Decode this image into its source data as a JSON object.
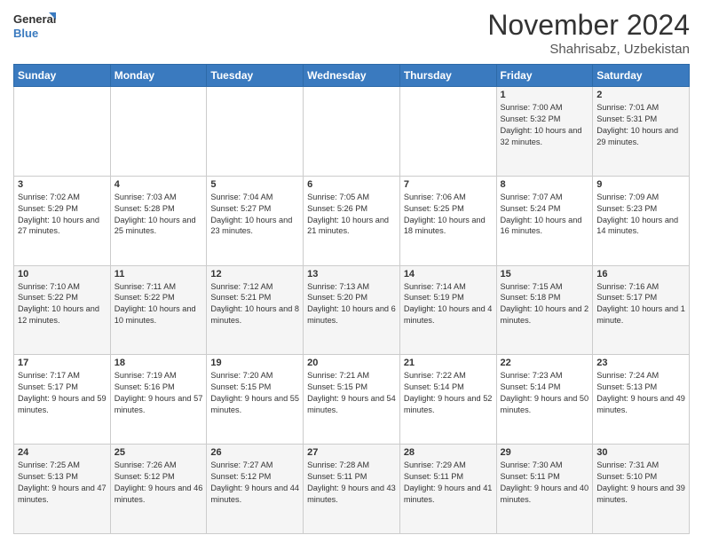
{
  "header": {
    "logo_general": "General",
    "logo_blue": "Blue",
    "month_title": "November 2024",
    "location": "Shahrisabz, Uzbekistan"
  },
  "days_of_week": [
    "Sunday",
    "Monday",
    "Tuesday",
    "Wednesday",
    "Thursday",
    "Friday",
    "Saturday"
  ],
  "weeks": [
    [
      {
        "day": "",
        "empty": true
      },
      {
        "day": "",
        "empty": true
      },
      {
        "day": "",
        "empty": true
      },
      {
        "day": "",
        "empty": true
      },
      {
        "day": "",
        "empty": true
      },
      {
        "day": "1",
        "sunrise": "7:00 AM",
        "sunset": "5:32 PM",
        "daylight": "10 hours and 32 minutes."
      },
      {
        "day": "2",
        "sunrise": "7:01 AM",
        "sunset": "5:31 PM",
        "daylight": "10 hours and 29 minutes."
      }
    ],
    [
      {
        "day": "3",
        "sunrise": "7:02 AM",
        "sunset": "5:29 PM",
        "daylight": "10 hours and 27 minutes."
      },
      {
        "day": "4",
        "sunrise": "7:03 AM",
        "sunset": "5:28 PM",
        "daylight": "10 hours and 25 minutes."
      },
      {
        "day": "5",
        "sunrise": "7:04 AM",
        "sunset": "5:27 PM",
        "daylight": "10 hours and 23 minutes."
      },
      {
        "day": "6",
        "sunrise": "7:05 AM",
        "sunset": "5:26 PM",
        "daylight": "10 hours and 21 minutes."
      },
      {
        "day": "7",
        "sunrise": "7:06 AM",
        "sunset": "5:25 PM",
        "daylight": "10 hours and 18 minutes."
      },
      {
        "day": "8",
        "sunrise": "7:07 AM",
        "sunset": "5:24 PM",
        "daylight": "10 hours and 16 minutes."
      },
      {
        "day": "9",
        "sunrise": "7:09 AM",
        "sunset": "5:23 PM",
        "daylight": "10 hours and 14 minutes."
      }
    ],
    [
      {
        "day": "10",
        "sunrise": "7:10 AM",
        "sunset": "5:22 PM",
        "daylight": "10 hours and 12 minutes."
      },
      {
        "day": "11",
        "sunrise": "7:11 AM",
        "sunset": "5:22 PM",
        "daylight": "10 hours and 10 minutes."
      },
      {
        "day": "12",
        "sunrise": "7:12 AM",
        "sunset": "5:21 PM",
        "daylight": "10 hours and 8 minutes."
      },
      {
        "day": "13",
        "sunrise": "7:13 AM",
        "sunset": "5:20 PM",
        "daylight": "10 hours and 6 minutes."
      },
      {
        "day": "14",
        "sunrise": "7:14 AM",
        "sunset": "5:19 PM",
        "daylight": "10 hours and 4 minutes."
      },
      {
        "day": "15",
        "sunrise": "7:15 AM",
        "sunset": "5:18 PM",
        "daylight": "10 hours and 2 minutes."
      },
      {
        "day": "16",
        "sunrise": "7:16 AM",
        "sunset": "5:17 PM",
        "daylight": "10 hours and 1 minute."
      }
    ],
    [
      {
        "day": "17",
        "sunrise": "7:17 AM",
        "sunset": "5:17 PM",
        "daylight": "9 hours and 59 minutes."
      },
      {
        "day": "18",
        "sunrise": "7:19 AM",
        "sunset": "5:16 PM",
        "daylight": "9 hours and 57 minutes."
      },
      {
        "day": "19",
        "sunrise": "7:20 AM",
        "sunset": "5:15 PM",
        "daylight": "9 hours and 55 minutes."
      },
      {
        "day": "20",
        "sunrise": "7:21 AM",
        "sunset": "5:15 PM",
        "daylight": "9 hours and 54 minutes."
      },
      {
        "day": "21",
        "sunrise": "7:22 AM",
        "sunset": "5:14 PM",
        "daylight": "9 hours and 52 minutes."
      },
      {
        "day": "22",
        "sunrise": "7:23 AM",
        "sunset": "5:14 PM",
        "daylight": "9 hours and 50 minutes."
      },
      {
        "day": "23",
        "sunrise": "7:24 AM",
        "sunset": "5:13 PM",
        "daylight": "9 hours and 49 minutes."
      }
    ],
    [
      {
        "day": "24",
        "sunrise": "7:25 AM",
        "sunset": "5:13 PM",
        "daylight": "9 hours and 47 minutes."
      },
      {
        "day": "25",
        "sunrise": "7:26 AM",
        "sunset": "5:12 PM",
        "daylight": "9 hours and 46 minutes."
      },
      {
        "day": "26",
        "sunrise": "7:27 AM",
        "sunset": "5:12 PM",
        "daylight": "9 hours and 44 minutes."
      },
      {
        "day": "27",
        "sunrise": "7:28 AM",
        "sunset": "5:11 PM",
        "daylight": "9 hours and 43 minutes."
      },
      {
        "day": "28",
        "sunrise": "7:29 AM",
        "sunset": "5:11 PM",
        "daylight": "9 hours and 41 minutes."
      },
      {
        "day": "29",
        "sunrise": "7:30 AM",
        "sunset": "5:11 PM",
        "daylight": "9 hours and 40 minutes."
      },
      {
        "day": "30",
        "sunrise": "7:31 AM",
        "sunset": "5:10 PM",
        "daylight": "9 hours and 39 minutes."
      }
    ]
  ]
}
